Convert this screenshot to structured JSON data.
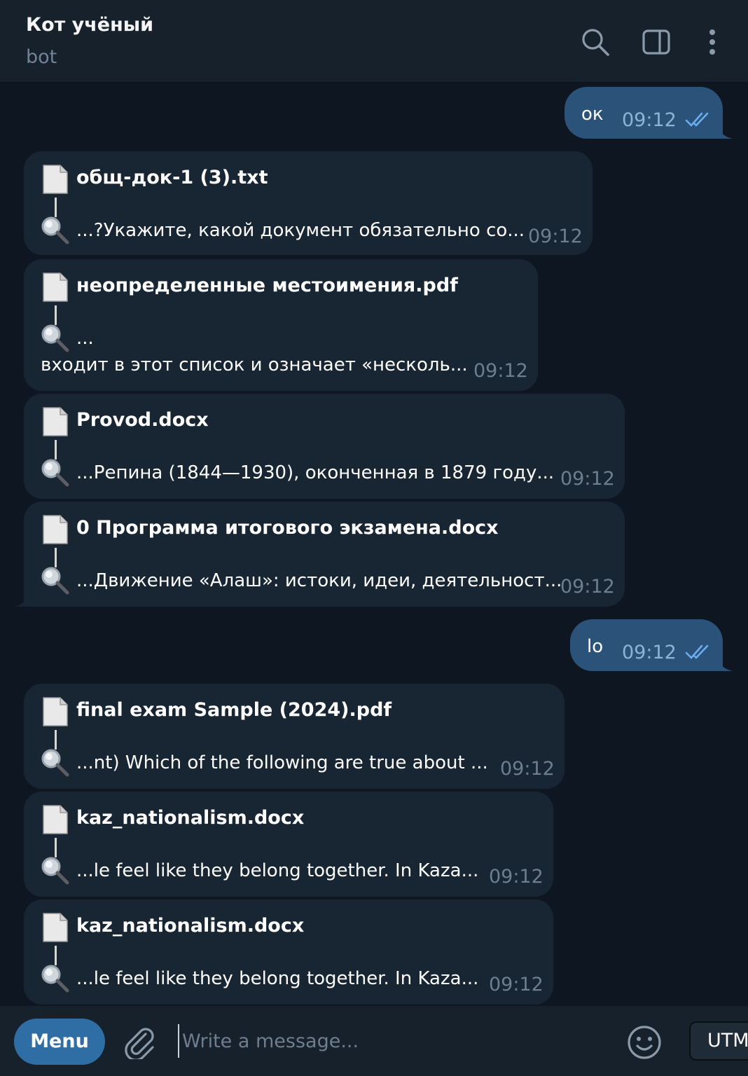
{
  "header": {
    "title": "Кот учёный",
    "subtitle": "bot",
    "icons": [
      "search-icon",
      "sidebar-toggle-icon",
      "more-vertical-icon"
    ]
  },
  "messages": [
    {
      "dir": "out",
      "text": "ок",
      "time": "09:12",
      "status": "read"
    },
    {
      "dir": "in",
      "filename": "общ-док-1 (3).txt",
      "snippet": "...?Укажите, какой документ обязательно со...",
      "time": "09:12"
    },
    {
      "dir": "in",
      "filename": "неопределенные местоимения.pdf",
      "snippet": "...",
      "snippet_line2": "входит в этот список и означает «несколь...",
      "time": "09:12"
    },
    {
      "dir": "in",
      "filename": "Provod.docx",
      "snippet": "...Репина (1844—1930), оконченная в 1879 году...",
      "time": "09:12"
    },
    {
      "dir": "in",
      "filename": "0 Программа итогового экзамена.docx",
      "snippet": "...Движение «Алаш»: истоки, идеи, деятельност...",
      "time": "09:12"
    },
    {
      "dir": "out",
      "text": "lo",
      "time": "09:12",
      "status": "read"
    },
    {
      "dir": "in",
      "filename": "final exam Sample (2024).pdf",
      "snippet": "...nt) Which of the following are true about ...",
      "time": "09:12"
    },
    {
      "dir": "in",
      "filename": "kaz_nationalism.docx",
      "snippet": "...le feel like they belong together. In Kaza...",
      "time": "09:12"
    },
    {
      "dir": "in",
      "filename": "kaz_nationalism.docx",
      "snippet": "...le feel like they belong together. In Kaza...",
      "time": "09:12"
    }
  ],
  "composer": {
    "menu_label": "Menu",
    "placeholder": "Write a message...",
    "tooltip": "UTM"
  },
  "colors": {
    "background": "#0e1621",
    "header": "#17212b",
    "incoming_bubble": "#182533",
    "outgoing_bubble": "#2b5278",
    "accent": "#2f6ea5",
    "read_check": "#6aaef0"
  }
}
